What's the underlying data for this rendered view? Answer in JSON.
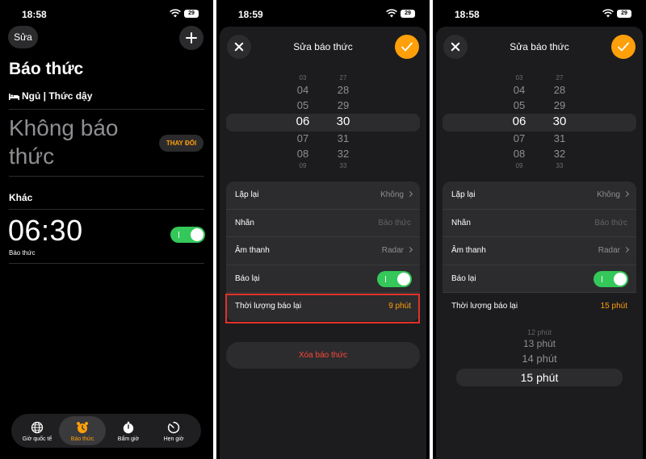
{
  "screen1": {
    "status_time": "18:58",
    "battery": "29",
    "edit_label": "Sửa",
    "title": "Báo thức",
    "sleep_label": "Ngủ | Thức dậy",
    "no_alarm": "Không báo thức",
    "change_label": "THAY ĐỔI",
    "other_label": "Khác",
    "alarm_time": "06:30",
    "alarm_label": "Báo thức",
    "alarm_enabled": true,
    "tabs": [
      {
        "label": "Giờ quốc tế",
        "icon": "globe-icon",
        "active": false
      },
      {
        "label": "Báo thức",
        "icon": "alarm-clock-icon",
        "active": true
      },
      {
        "label": "Bấm giờ",
        "icon": "stopwatch-icon",
        "active": false
      },
      {
        "label": "Hẹn giờ",
        "icon": "timer-icon",
        "active": false
      }
    ]
  },
  "screen2": {
    "status_time": "18:59",
    "battery": "29",
    "sheet_title": "Sửa báo thức",
    "hours": [
      "03",
      "04",
      "05",
      "06",
      "07",
      "08",
      "09"
    ],
    "minutes": [
      "27",
      "28",
      "29",
      "30",
      "31",
      "32",
      "33"
    ],
    "rows": {
      "repeat_label": "Lặp lại",
      "repeat_value": "Không",
      "label_label": "Nhãn",
      "label_placeholder": "Báo thức",
      "sound_label": "Âm thanh",
      "sound_value": "Radar",
      "snooze_label": "Báo lại",
      "snooze_enabled": true,
      "snooze_duration_label": "Thời lượng báo lại",
      "snooze_duration_value": "9 phút"
    },
    "delete_label": "Xóa báo thức"
  },
  "screen3": {
    "status_time": "18:58",
    "battery": "29",
    "sheet_title": "Sửa báo thức",
    "hours": [
      "03",
      "04",
      "05",
      "06",
      "07",
      "08",
      "09"
    ],
    "minutes": [
      "27",
      "28",
      "29",
      "30",
      "31",
      "32",
      "33"
    ],
    "rows": {
      "repeat_label": "Lặp lại",
      "repeat_value": "Không",
      "label_label": "Nhãn",
      "label_placeholder": "Báo thức",
      "sound_label": "Âm thanh",
      "sound_value": "Radar",
      "snooze_label": "Báo lại",
      "snooze_enabled": true,
      "snooze_duration_label": "Thời lượng báo lại",
      "snooze_duration_value": "15 phút"
    },
    "snooze_options": [
      "12 phút",
      "13 phút",
      "14 phút",
      "15 phút"
    ]
  },
  "colors": {
    "accent": "#ff9f0a",
    "toggle_on": "#34c759",
    "destructive": "#ff453a",
    "highlight": "#e0322a"
  }
}
